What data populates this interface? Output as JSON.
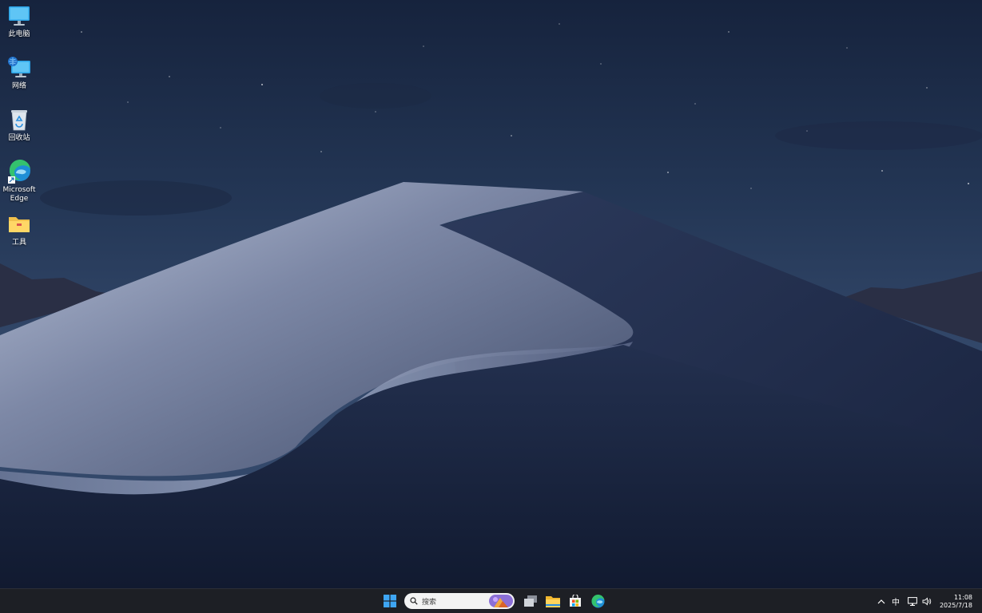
{
  "desktop": {
    "icons": [
      {
        "label": "此电脑",
        "icon": "computer-icon"
      },
      {
        "label": "网络",
        "icon": "network-icon"
      },
      {
        "label": "回收站",
        "icon": "recycle-bin-icon"
      },
      {
        "label": "Microsoft Edge",
        "icon": "edge-icon"
      },
      {
        "label": "工具",
        "icon": "folder-icon"
      }
    ]
  },
  "taskbar": {
    "start_icon": "windows-start-icon",
    "search": {
      "placeholder": "搜索",
      "icon": "search-icon"
    },
    "apps": [
      {
        "name": "task-view",
        "icon": "task-view-icon"
      },
      {
        "name": "file-explorer",
        "icon": "file-explorer-icon"
      },
      {
        "name": "microsoft-store",
        "icon": "store-icon"
      },
      {
        "name": "edge",
        "icon": "edge-icon"
      }
    ],
    "tray": {
      "chevron_icon": "chevron-up-icon",
      "ime_label": "中",
      "network_icon": "network-status-icon",
      "volume_icon": "volume-icon"
    },
    "clock": {
      "time": "11:08",
      "date": "2025/7/18"
    }
  },
  "colors": {
    "taskbar_bg": "#1d1f25",
    "accent": "#0078d4",
    "sky_top": "#1a2947",
    "dune_light": "#8e9ab8"
  }
}
